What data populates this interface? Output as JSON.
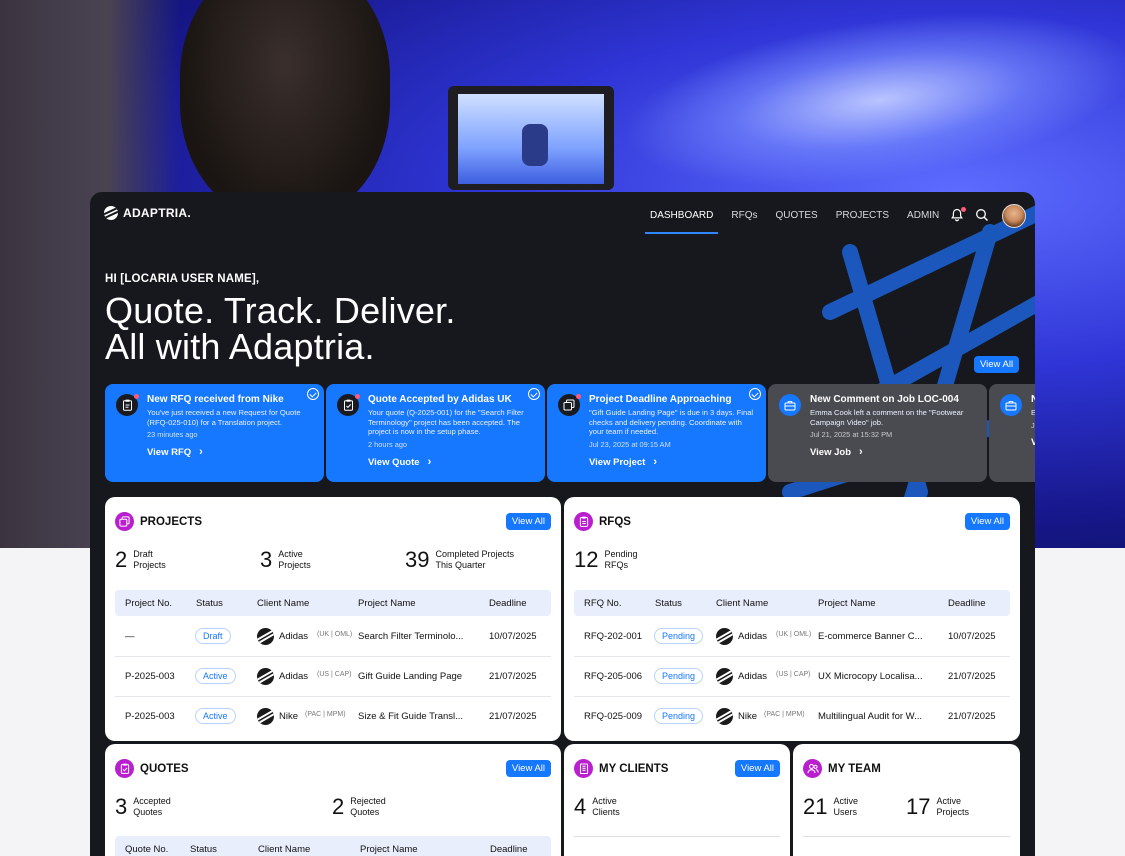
{
  "nav": {
    "brand": "ADAPTRIA.",
    "items": [
      "DASHBOARD",
      "RFQs",
      "QUOTES",
      "PROJECTS",
      "ADMIN"
    ],
    "active": "DASHBOARD"
  },
  "hero": {
    "greeting": "HI [LOCARIA USER NAME],",
    "line1": "Quote. Track. Deliver.",
    "line2": "All with Adaptria.",
    "view_all": "View All"
  },
  "notifications": [
    {
      "title": "New RFQ received from Nike",
      "body": "You've just received a new Request for Quote (RFQ-025-010) for a Translation project.",
      "time": "23 minutes ago",
      "link": "View RFQ",
      "icon": "clipboard-icon",
      "color": "blue",
      "checked": true,
      "unread": true
    },
    {
      "title": "Quote Accepted by Adidas UK",
      "body": "Your quote (Q-2025-001) for the \"Search Filter Terminology\" project has been accepted. The project is now in the setup phase.",
      "time": "2 hours ago",
      "link": "View Quote",
      "icon": "clipboard-check-icon",
      "color": "blue",
      "checked": true,
      "unread": true
    },
    {
      "title": "Project Deadline Approaching",
      "body": "\"Gift Guide Landing Page\" is due in 3 days. Final checks and delivery pending. Coordinate with your team if needed.",
      "time": "Jul 23, 2025 at 09:15 AM",
      "link": "View Project",
      "icon": "copy-icon",
      "color": "blue",
      "checked": true,
      "unread": true
    },
    {
      "title": "New Comment on Job LOC-004",
      "body": "Emma Cook left a comment on the \"Footwear Campaign Video\" job.",
      "time": "Jul 21, 2025 at 15:32 PM",
      "link": "View Job",
      "icon": "briefcase-icon",
      "color": "gray",
      "checked": false,
      "unread": false
    },
    {
      "title": "N",
      "body": "E",
      "time": "J",
      "link": "V",
      "icon": "briefcase-icon",
      "color": "gray",
      "checked": false,
      "unread": false
    }
  ],
  "projects": {
    "title": "PROJECTS",
    "view_all": "View All",
    "stats": [
      {
        "num": "2",
        "label1": "Draft",
        "label2": "Projects"
      },
      {
        "num": "3",
        "label1": "Active",
        "label2": "Projects"
      },
      {
        "num": "39",
        "label1": "Completed Projects",
        "label2": "This Quarter"
      }
    ],
    "columns": [
      "Project No.",
      "Status",
      "Client Name",
      "Project Name",
      "Deadline"
    ],
    "rows": [
      {
        "no": "—",
        "status": "Draft",
        "client": "Adidas",
        "region": "(UK | OML)",
        "name": "Search Filter Terminolo...",
        "deadline": "10/07/2025"
      },
      {
        "no": "P-2025-003",
        "status": "Active",
        "client": "Adidas",
        "region": "(US | CAP)",
        "name": "Gift Guide Landing Page",
        "deadline": "21/07/2025"
      },
      {
        "no": "P-2025-003",
        "status": "Active",
        "client": "Nike",
        "region": "(PAC | MPM)",
        "name": "Size & Fit Guide Transl...",
        "deadline": "21/07/2025"
      }
    ]
  },
  "rfqs": {
    "title": "RFQS",
    "view_all": "View All",
    "stats": [
      {
        "num": "12",
        "label1": "Pending",
        "label2": "RFQs"
      }
    ],
    "columns": [
      "RFQ No.",
      "Status",
      "Client Name",
      "Project Name",
      "Deadline"
    ],
    "rows": [
      {
        "no": "RFQ-202-001",
        "status": "Pending",
        "client": "Adidas",
        "region": "(UK | OML)",
        "name": "E-commerce Banner C...",
        "deadline": "10/07/2025"
      },
      {
        "no": "RFQ-205-006",
        "status": "Pending",
        "client": "Adidas",
        "region": "(US | CAP)",
        "name": "UX Microcopy Localisa...",
        "deadline": "21/07/2025"
      },
      {
        "no": "RFQ-025-009",
        "status": "Pending",
        "client": "Nike",
        "region": "(PAC | MPM)",
        "name": "Multilingual Audit for W...",
        "deadline": "21/07/2025"
      }
    ]
  },
  "quotes": {
    "title": "QUOTES",
    "view_all": "View All",
    "stats": [
      {
        "num": "3",
        "label1": "Accepted",
        "label2": "Quotes"
      },
      {
        "num": "2",
        "label1": "Rejected",
        "label2": "Quotes"
      }
    ],
    "columns": [
      "Quote No.",
      "Status",
      "Client Name",
      "Project Name",
      "Deadline"
    ]
  },
  "clients": {
    "title": "MY CLIENTS",
    "view_all": "View All",
    "stats": [
      {
        "num": "4",
        "label1": "Active",
        "label2": "Clients"
      }
    ]
  },
  "team": {
    "title": "MY TEAM",
    "stats": [
      {
        "num": "21",
        "label1": "Active",
        "label2": "Users"
      },
      {
        "num": "17",
        "label1": "Active",
        "label2": "Projects"
      }
    ]
  },
  "colors": {
    "accent": "#1677ff",
    "panel_icon": "#b91ecf",
    "dark": "#16181d",
    "notification_gray": "#4a4b50"
  }
}
